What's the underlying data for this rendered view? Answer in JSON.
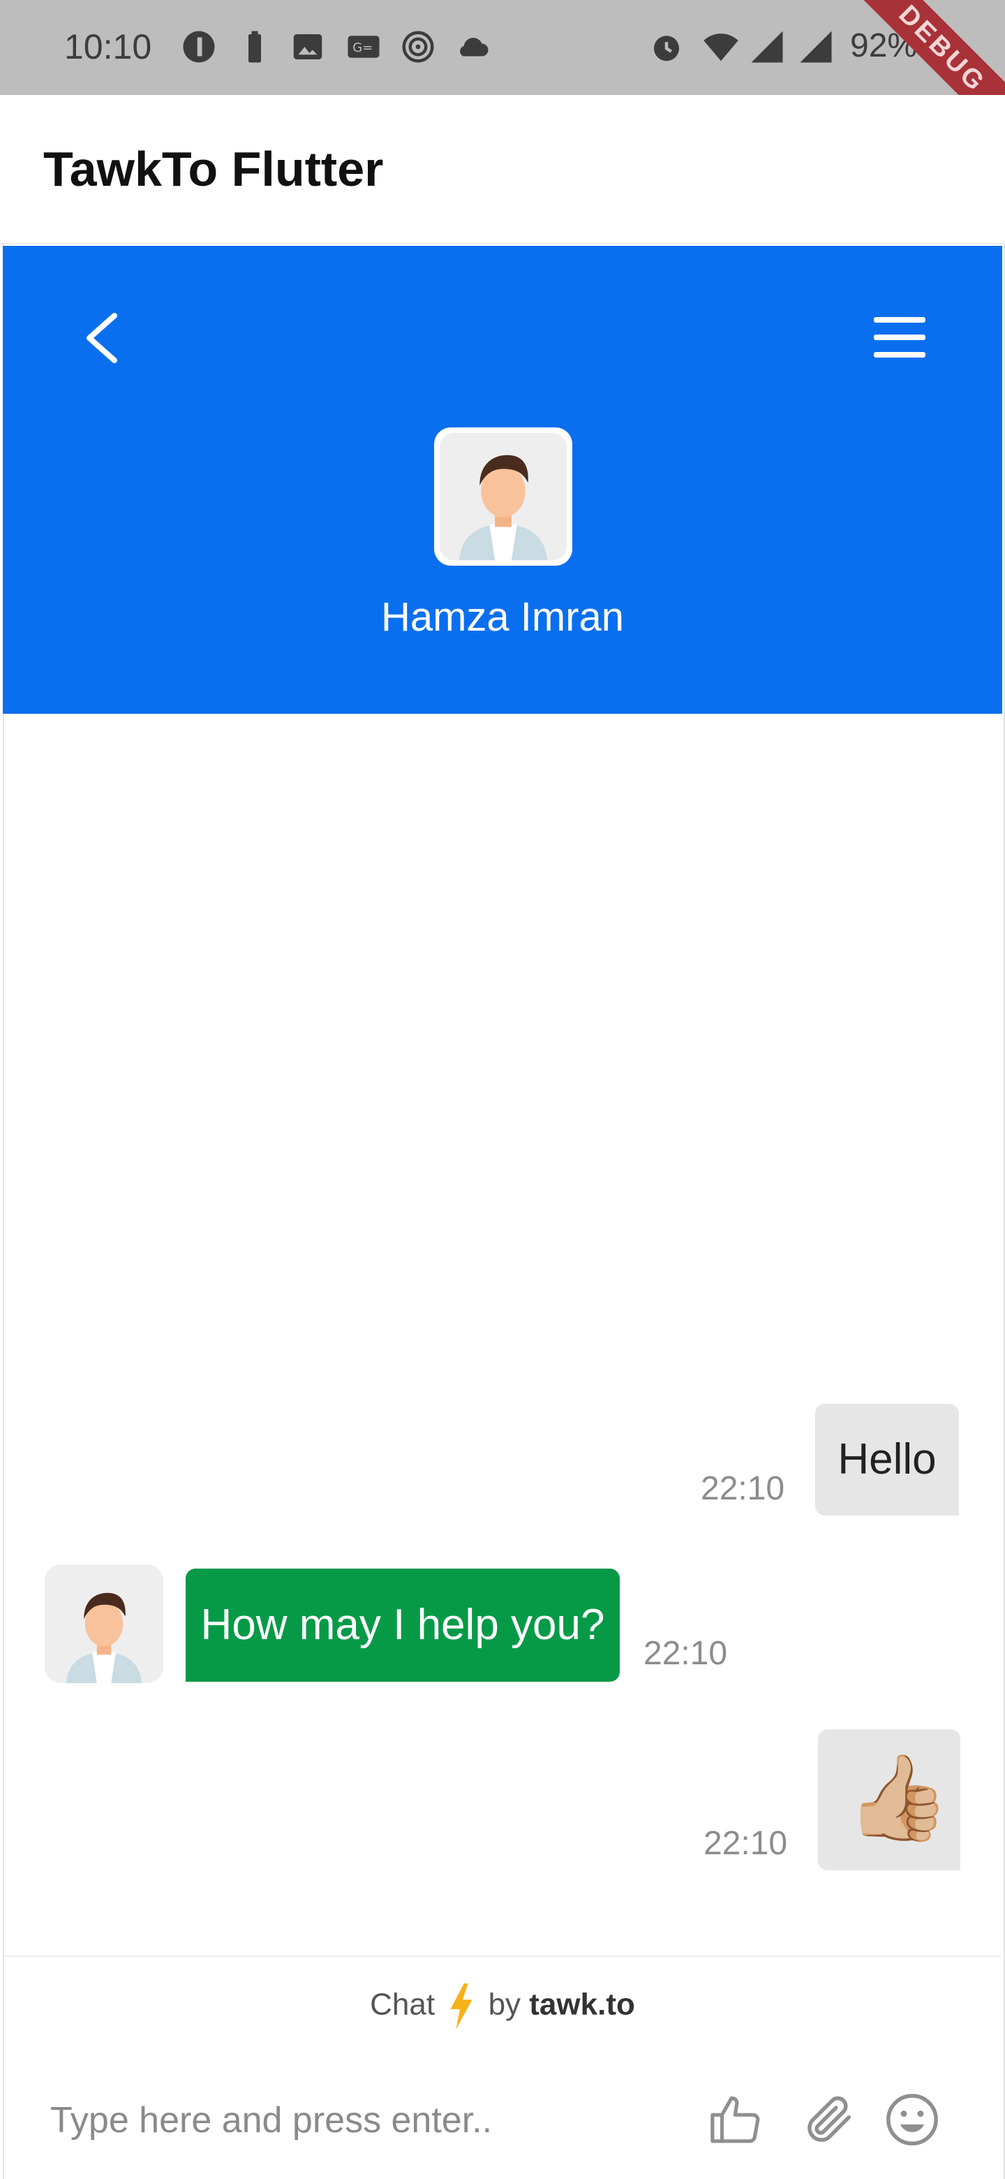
{
  "status_bar": {
    "time": "10:10",
    "battery_percent": "92%",
    "debug_label": "DEBUG",
    "icons": [
      "account-icon",
      "battery-icon",
      "image-icon",
      "news-icon",
      "hotspot-icon",
      "cloud-icon",
      "alarm-icon",
      "wifi-icon",
      "signal-icon",
      "signal-icon",
      "battery-icon"
    ]
  },
  "app_bar": {
    "title": "TawkTo Flutter"
  },
  "chat_header": {
    "back_icon": "chevron-left-icon",
    "menu_icon": "hamburger-menu-icon",
    "agent_name": "Hamza Imran"
  },
  "messages": [
    {
      "from": "visitor",
      "text": "Hello",
      "time": "22:10"
    },
    {
      "from": "agent",
      "text": "How may I help you?",
      "time": "22:10"
    },
    {
      "from": "visitor",
      "emoji": "👍🏼",
      "time": "22:10"
    }
  ],
  "footer": {
    "powered_prefix": "Chat",
    "powered_by": "by",
    "brand": "tawk.to"
  },
  "composer": {
    "placeholder": "Type here and press enter..",
    "value": ""
  },
  "colors": {
    "header_blue": "#0a6fef",
    "agent_bubble": "#069a47",
    "visitor_bubble": "#e6e6e6"
  }
}
